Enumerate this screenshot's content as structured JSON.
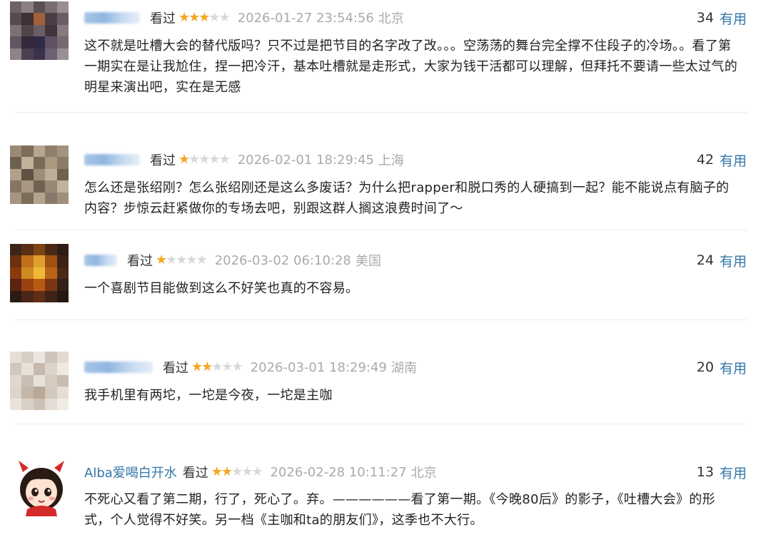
{
  "reviews": [
    {
      "username": "",
      "watched_label": "看过",
      "rating": 3,
      "datetime": "2026-01-27 23:54:56",
      "location": "北京",
      "votes": "34",
      "useful_label": "有用",
      "content": "这不就是吐槽大会的替代版吗？只不过是把节目的名字改了改。。。空荡荡的舞台完全撑不住段子的冷场。。看了第一期实在是让我尬住，捏一把冷汗，基本吐槽就是走形式，大家为钱干活都可以理解，但拜托不要请一些太过气的明星来演出吧，实在是无感"
    },
    {
      "username": "",
      "watched_label": "看过",
      "rating": 1,
      "datetime": "2026-02-01 18:29:45",
      "location": "上海",
      "votes": "42",
      "useful_label": "有用",
      "content": "怎么还是张绍刚？怎么张绍刚还是这么多废话？为什么把rapper和脱口秀的人硬搞到一起？能不能说点有脑子的内容？步惊云赶紧做你的专场去吧，别跟这群人搁这浪费时间了～"
    },
    {
      "username": "",
      "watched_label": "看过",
      "rating": 1,
      "datetime": "2026-03-02 06:10:28",
      "location": "美国",
      "votes": "24",
      "useful_label": "有用",
      "content": "一个喜剧节目能做到这么不好笑也真的不容易。"
    },
    {
      "username": "",
      "watched_label": "看过",
      "rating": 2,
      "datetime": "2026-03-01 18:29:49",
      "location": "湖南",
      "votes": "20",
      "useful_label": "有用",
      "content": "我手机里有两坨，一坨是今夜，一坨是主咖"
    },
    {
      "username": "Alba爱喝白开水",
      "watched_label": "看过",
      "rating": 2,
      "datetime": "2026-02-28 10:11:27",
      "location": "北京",
      "votes": "13",
      "useful_label": "有用",
      "content": "不死心又看了第二期，行了，死心了。弃。——————看了第一期。《今晚80后》的影子，《吐槽大会》的形式，个人觉得不好笑。另一档《主咖和ta的朋友们》，这季也不大行。"
    }
  ],
  "icons": {
    "star_filled": "★",
    "star_empty": "★"
  },
  "colors": {
    "link_blue": "#3377aa",
    "star_gold": "#f5a623",
    "star_gray": "#d8d8d8",
    "meta_gray": "#aaaaaa"
  }
}
